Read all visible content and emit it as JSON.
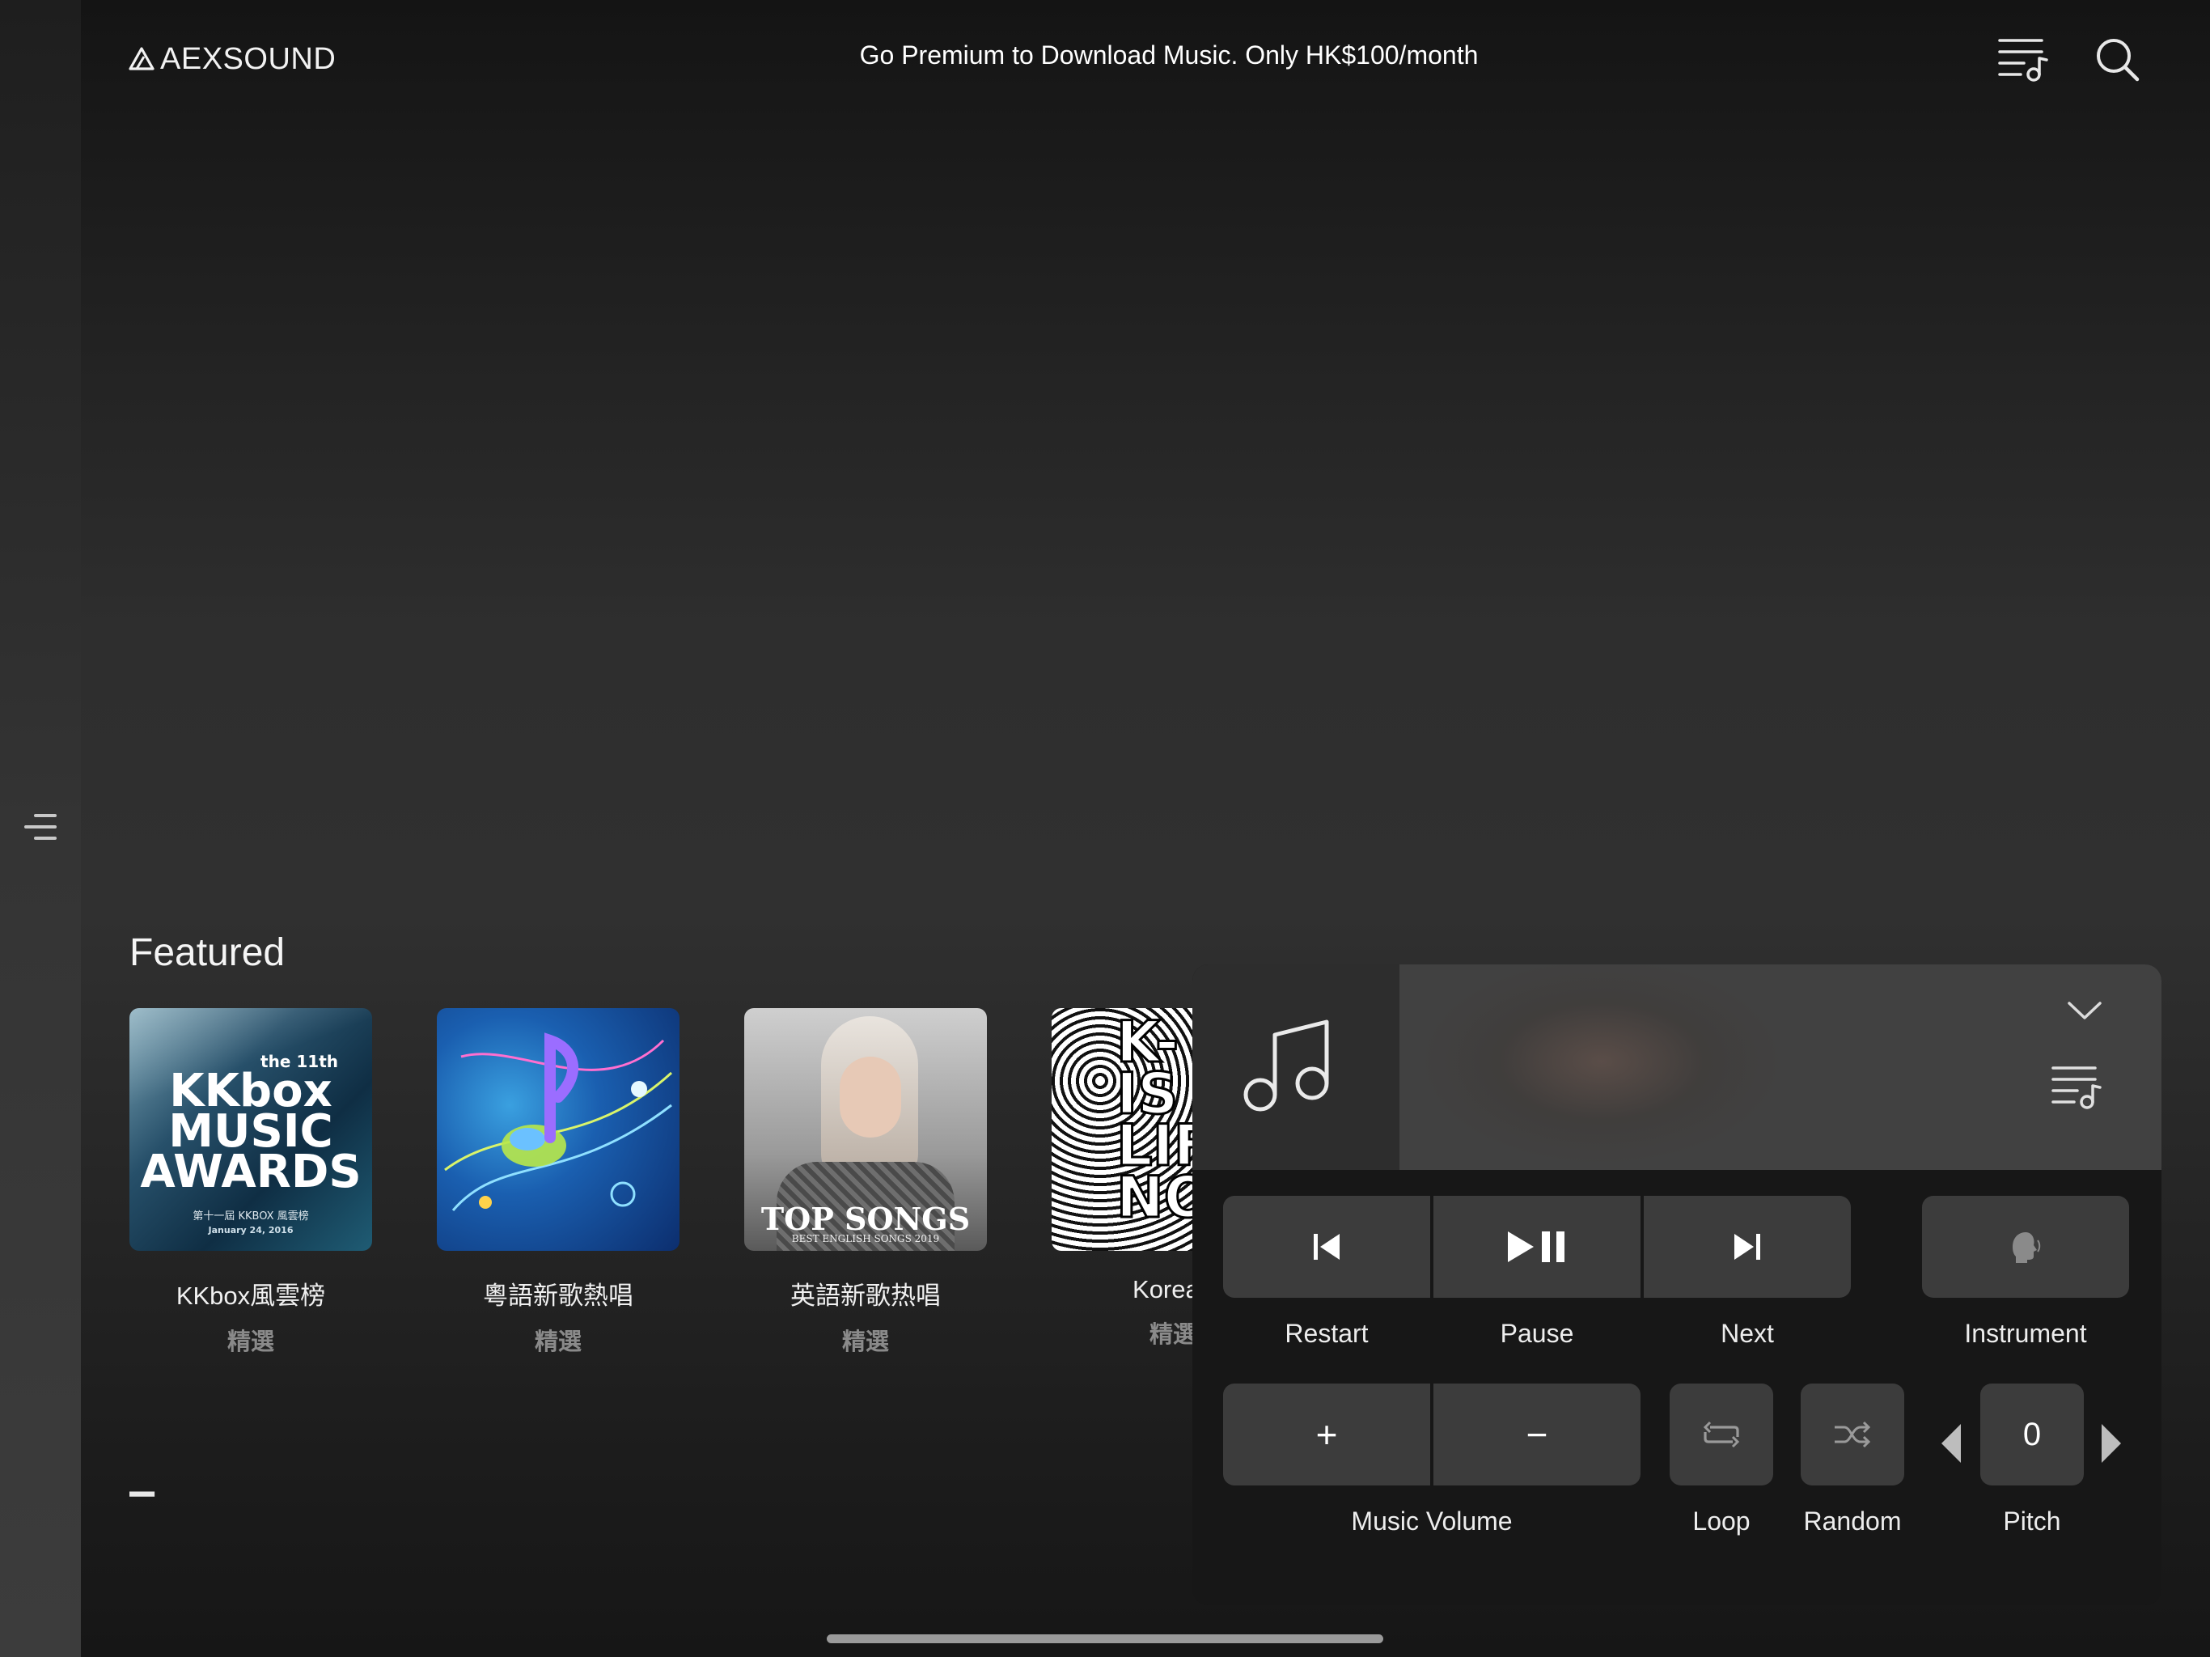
{
  "header": {
    "logo_text": "AEXSOUND",
    "promo_text": "Go Premium to Download Music. Only HK$100/month",
    "queue_icon": "playlist-music-icon",
    "search_icon": "search-icon"
  },
  "sidebar": {
    "toggle_icon": "menu-icon"
  },
  "featured": {
    "title": "Featured",
    "items": [
      {
        "title": "KKbox風雲榜",
        "subtitle": "精選",
        "cover_top": "the 11th",
        "cover_lines": [
          "KKbox",
          "MUSIC",
          "AWARDS"
        ],
        "cover_small": "第十一屆 KKBOX 風雲榜",
        "cover_date": "January 24, 2016"
      },
      {
        "title": "粵語新歌熱唱",
        "subtitle": "精選"
      },
      {
        "title": "英語新歌热唱",
        "subtitle": "精選",
        "cover_main": "TOP SONGS",
        "cover_small": "BEST ENGLISH SONGS 2019"
      },
      {
        "title": "Korea–",
        "subtitle": "精選",
        "cover_lines": [
          "K-",
          "IS M",
          "LIF",
          "NO"
        ]
      }
    ]
  },
  "player": {
    "art_icon": "music-note-icon",
    "collapse_icon": "chevron-down-icon",
    "queue_icon": "playlist-music-icon",
    "controls": {
      "restart": "Restart",
      "pause": "Pause",
      "next": "Next",
      "instrument": "Instrument",
      "volume_up_symbol": "+",
      "volume_down_symbol": "−",
      "music_volume": "Music Volume",
      "loop": "Loop",
      "random": "Random",
      "pitch_value": "0",
      "pitch": "Pitch"
    }
  },
  "colors": {
    "background": "#2e2e2e",
    "button": "#3c3c3c",
    "panel": "#171717",
    "subtitle": "#8a8a8a"
  }
}
